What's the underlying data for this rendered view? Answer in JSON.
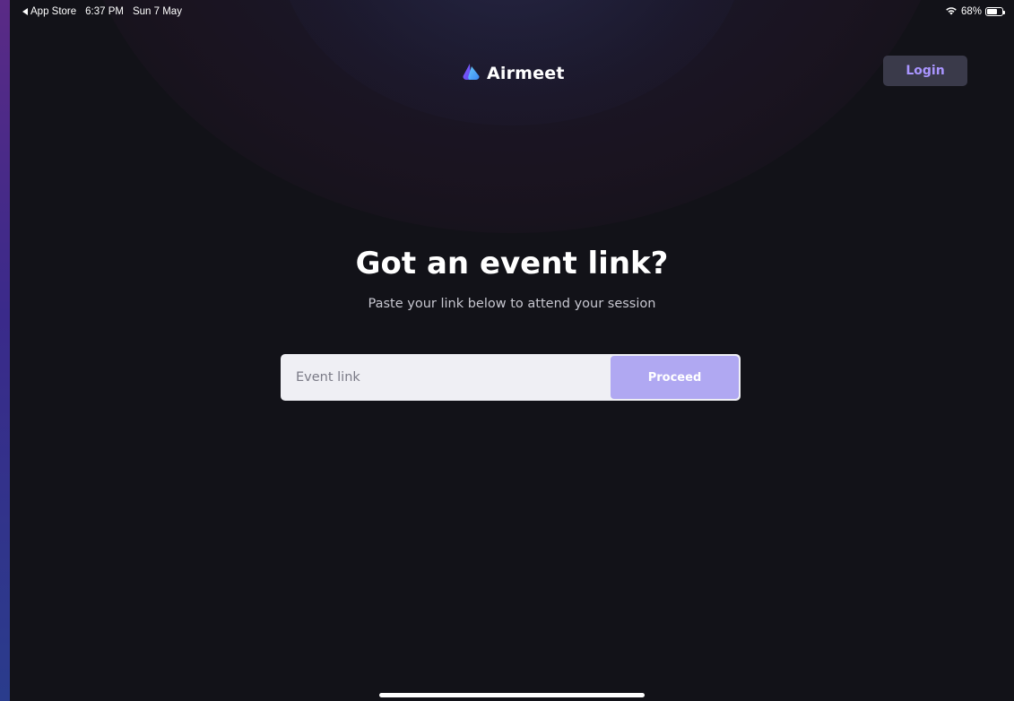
{
  "status_bar": {
    "back_app": "App Store",
    "time": "6:37 PM",
    "date": "Sun 7 May",
    "battery": "68%",
    "battery_level": 0.68,
    "icons": [
      "back-arrow-icon",
      "wifi-icon",
      "battery-icon"
    ]
  },
  "header": {
    "logo_text": "Airmeet",
    "login_label": "Login"
  },
  "main": {
    "heading": "Got an event link?",
    "subheading": "Paste your link below to attend your session",
    "input_placeholder": "Event link",
    "input_value": "",
    "proceed_label": "Proceed"
  },
  "colors": {
    "background": "#121218",
    "accent": "#a995ff",
    "proceed_button": "#b0a8f2",
    "login_button_bg": "#3a3a4a",
    "input_bg": "#efeff4",
    "logo_gradient": [
      "#7b5cff",
      "#4fb6ff"
    ]
  }
}
